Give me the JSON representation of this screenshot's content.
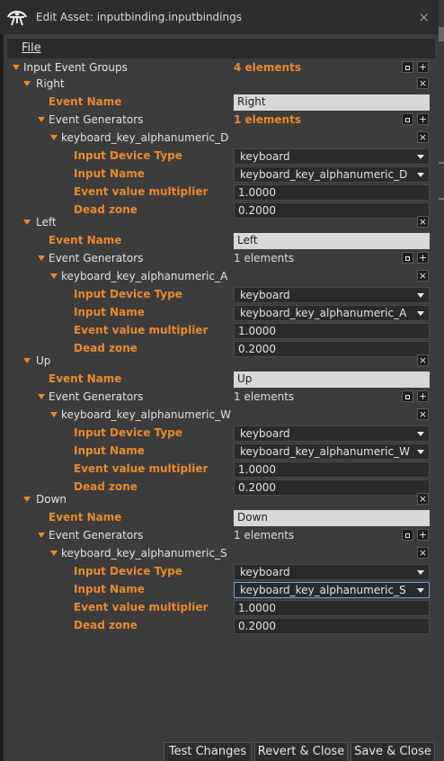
{
  "window": {
    "title": "Edit Asset: inputbinding.inputbindings",
    "close_label": "×"
  },
  "menu": {
    "file_label": "File"
  },
  "root": {
    "label": "Input Event Groups",
    "count": "4 elements"
  },
  "labels": {
    "event_name": "Event Name",
    "event_generators": "Event Generators",
    "input_device_type": "Input Device Type",
    "input_name": "Input Name",
    "multiplier": "Event value multiplier",
    "dead_zone": "Dead zone"
  },
  "groups": [
    {
      "name": "Right",
      "event_name": "Right",
      "generators_count": "1 elements",
      "generator": {
        "name": "keyboard_key_alphanumeric_D",
        "device_type": "keyboard",
        "input_name": "keyboard_key_alphanumeric_D",
        "multiplier": "1.0000",
        "dead_zone": "0.2000"
      }
    },
    {
      "name": "Left",
      "event_name": "Left",
      "generators_count": "1 elements",
      "generator": {
        "name": "keyboard_key_alphanumeric_A",
        "device_type": "keyboard",
        "input_name": "keyboard_key_alphanumeric_A",
        "multiplier": "1.0000",
        "dead_zone": "0.2000"
      }
    },
    {
      "name": "Up",
      "event_name": "Up",
      "generators_count": "1 elements",
      "generator": {
        "name": "keyboard_key_alphanumeric_W",
        "device_type": "keyboard",
        "input_name": "keyboard_key_alphanumeric_W",
        "multiplier": "1.0000",
        "dead_zone": "0.2000"
      }
    },
    {
      "name": "Down",
      "event_name": "Down",
      "generators_count": "1 elements",
      "generator": {
        "name": "keyboard_key_alphanumeric_S",
        "device_type": "keyboard",
        "input_name": "keyboard_key_alphanumeric_S",
        "multiplier": "1.0000",
        "dead_zone": "0.2000"
      }
    }
  ],
  "buttons": {
    "add": "+",
    "remove": "×",
    "test": "Test Changes",
    "revert": "Revert & Close",
    "save": "Save & Close"
  },
  "colors": {
    "accent_orange": "#e88a2e",
    "focus_blue": "#6e9edc",
    "panel": "#3c3c3c"
  }
}
